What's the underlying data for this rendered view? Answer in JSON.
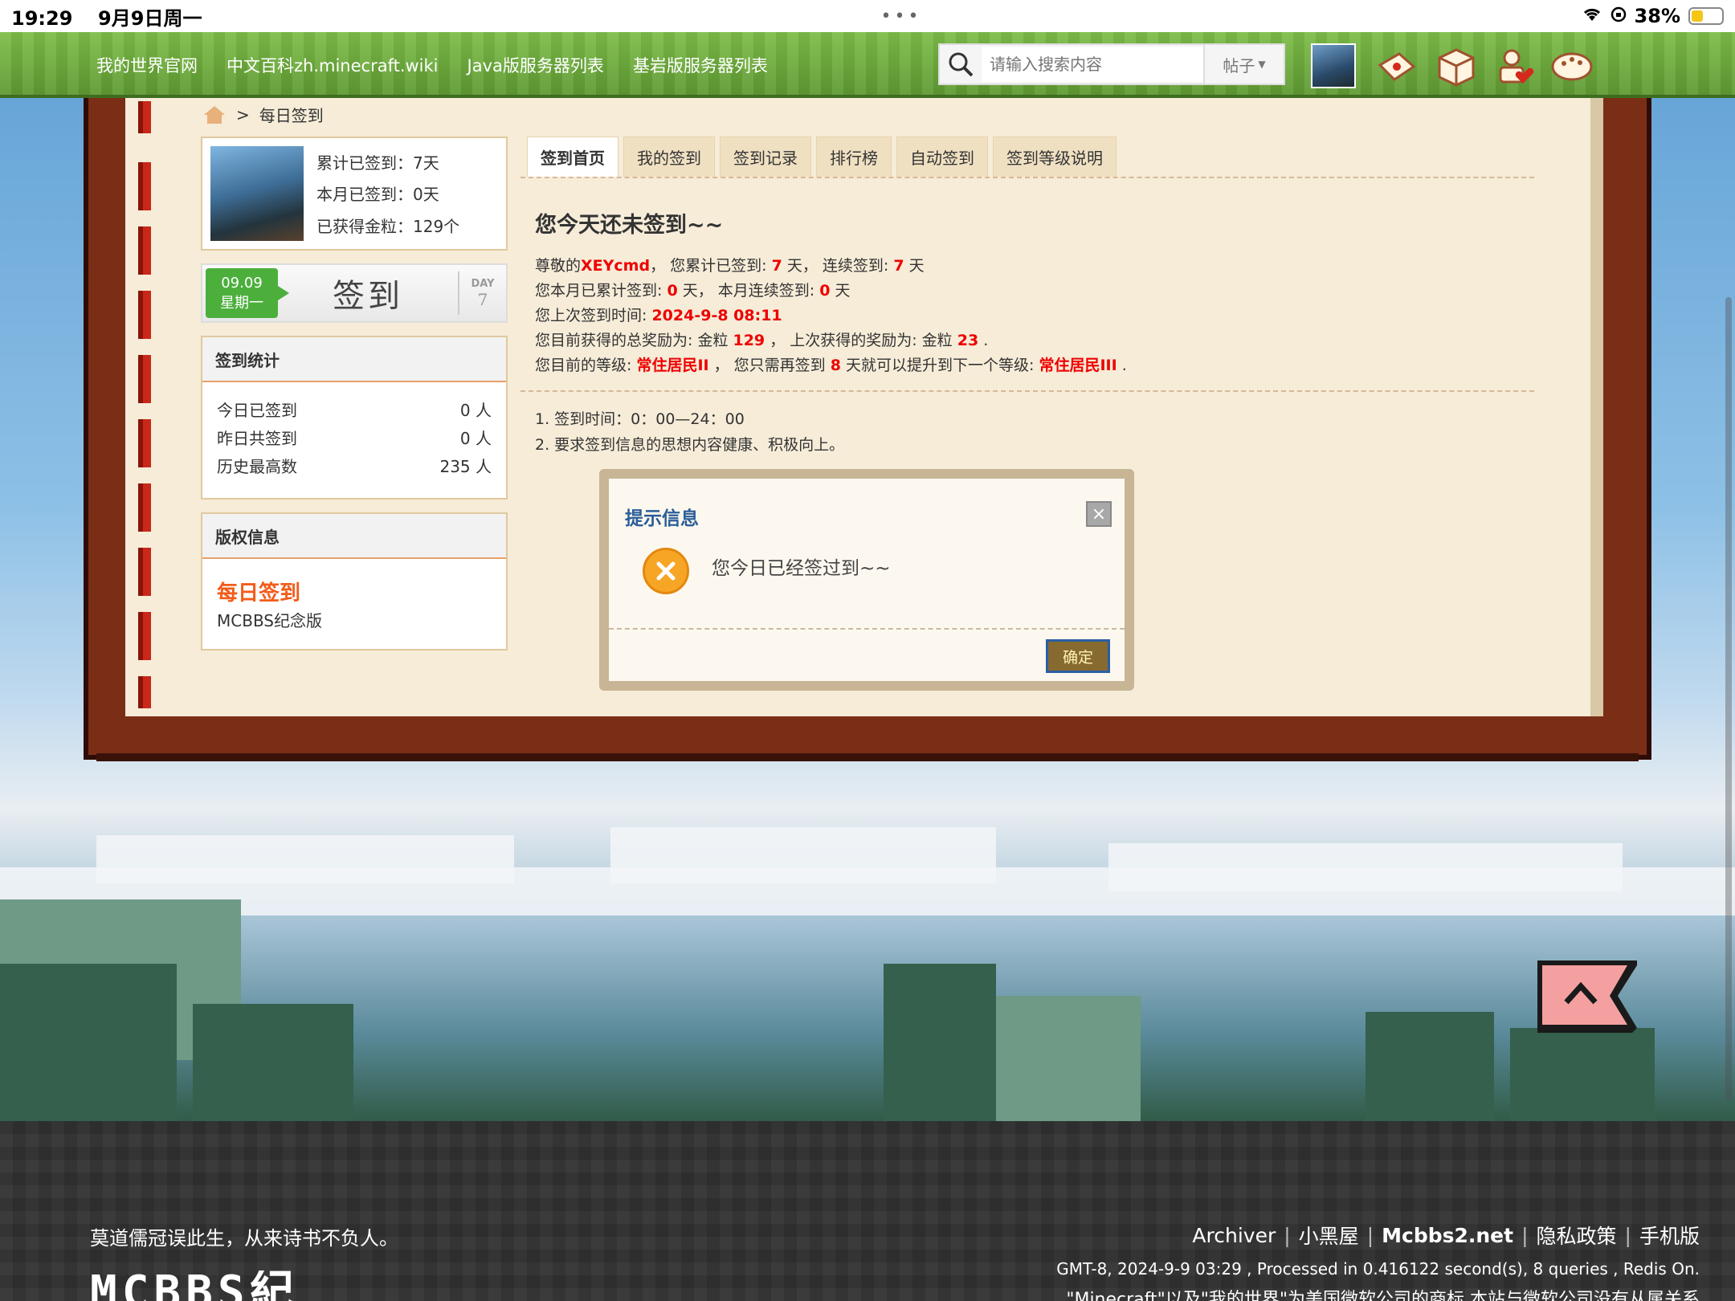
{
  "status_bar": {
    "time": "19:29",
    "date": "9月9日周一",
    "battery": "38%",
    "battery_level": 0.38
  },
  "nav": {
    "links": [
      "我的世界官网",
      "中文百科zh.minecraft.wiki",
      "Java版服务器列表",
      "基岩版服务器列表"
    ],
    "search_placeholder": "请输入搜索内容",
    "search_type": "帖子",
    "icons": [
      "envelope-icon",
      "gift-box-icon",
      "user-heart-icon",
      "palette-icon"
    ]
  },
  "breadcrumb": {
    "current": "每日签到"
  },
  "user_card": {
    "total": "累计已签到：7天",
    "month": "本月已签到：0天",
    "coins": "已获得金粒：129个"
  },
  "signin": {
    "date": "09.09",
    "weekday": "星期一",
    "button": "签到",
    "day_label": "DAY",
    "day_num": "7"
  },
  "stats": {
    "title": "签到统计",
    "rows": [
      {
        "label": "今日已签到",
        "value": "0 人"
      },
      {
        "label": "昨日共签到",
        "value": "0 人"
      },
      {
        "label": "历史最高数",
        "value": "235 人"
      }
    ]
  },
  "copyright": {
    "title": "版权信息",
    "name": "每日签到",
    "sub": "MCBBS纪念版"
  },
  "tabs": [
    "签到首页",
    "我的签到",
    "签到记录",
    "排行榜",
    "自动签到",
    "签到等级说明"
  ],
  "main": {
    "headline": "您今天还未签到~~",
    "line1": [
      "尊敬的",
      "XEYcmd",
      "，  您累计已签到: ",
      "7",
      " 天，  连续签到: ",
      "7",
      " 天"
    ],
    "line2": [
      "您本月已累计签到: ",
      "0",
      " 天，  本月连续签到: ",
      "0",
      " 天"
    ],
    "line3": [
      "您上次签到时间: ",
      "2024-9-8 08:11"
    ],
    "line4": [
      "您目前获得的总奖励为: 金粒 ",
      "129",
      " ，  上次获得的奖励为: 金粒 ",
      "23",
      " ."
    ],
    "line5": [
      "您目前的等级: ",
      "常住居民II",
      " ，  您只需再签到 ",
      "8",
      " 天就可以提升到下一个等级: ",
      "常住居民III",
      " ."
    ],
    "notes": [
      "1.  签到时间：0：00—24：00",
      "2.  要求签到信息的思想内容健康、积极向上。"
    ]
  },
  "dialog": {
    "title": "提示信息",
    "close": "×",
    "message": "您今日已经签过到~~",
    "ok": "确定"
  },
  "footer": {
    "quote": "莫道儒冠误此生，从来诗书不负人。",
    "logo": "MCBBS紀",
    "links": [
      "Archiver",
      "小黑屋",
      "Mcbbs2.net",
      "隐私政策",
      "手机版"
    ],
    "info": "GMT-8, 2024-9-9 03:29 , Processed in 0.416122 second(s), 8 queries , Redis On.",
    "legal": "\"Minecraft\"以及\"我的世界\"为美国微软公司的商标 本站与微软公司没有从属关系"
  },
  "colors": {
    "nav_green": "#6fae3f",
    "highlight_red": "#ee0000",
    "accent_orange": "#f25c19",
    "title_blue": "#2a5d98",
    "book_brown": "#7b2e16"
  }
}
